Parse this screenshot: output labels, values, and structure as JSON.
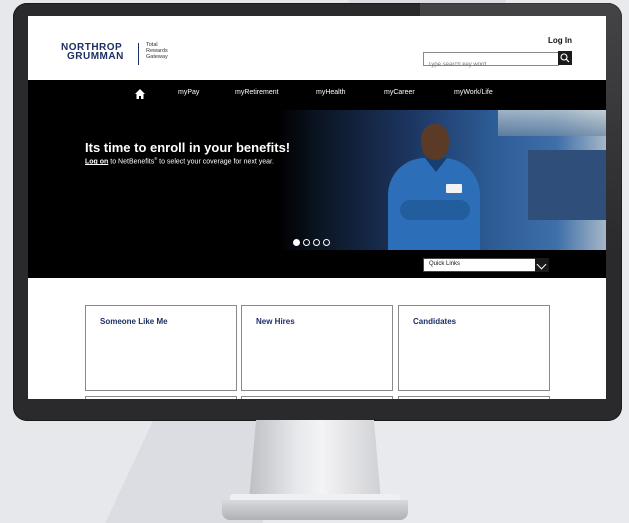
{
  "header": {
    "logo_line1": "NORTHROP",
    "logo_line2": "GRUMMAN",
    "sub_line1": "Total",
    "sub_line2": "Rewards",
    "sub_line3": "Gateway",
    "login_label": "Log In",
    "search_placeholder": "Type search key word"
  },
  "nav": {
    "items": [
      "myPay",
      "myRetirement",
      "myHealth",
      "myCareer",
      "myWork/Life"
    ]
  },
  "hero": {
    "title": "Its time to enroll in your benefits!",
    "link_text": "Log on",
    "subtitle_after_link": " to NetBenefits",
    "registered": "®",
    "subtitle_end": " to select your coverage for next year.",
    "slide_count": 4,
    "active_slide": 1
  },
  "quick_links": {
    "selected": "Quick Links"
  },
  "cards": [
    {
      "title": "Someone Like Me"
    },
    {
      "title": "New Hires"
    },
    {
      "title": "Candidates"
    }
  ],
  "colors": {
    "brand_navy": "#1b2f63",
    "nav_bg": "#000000",
    "bezel": "#2a2a2c"
  }
}
